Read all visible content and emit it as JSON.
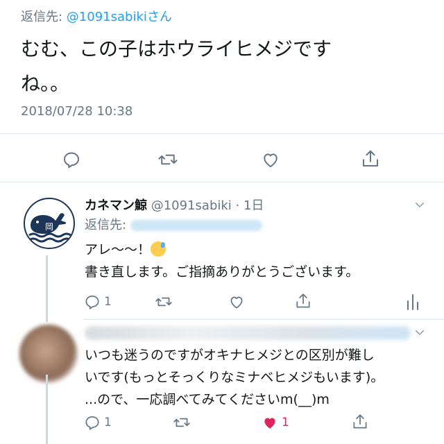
{
  "main_tweet": {
    "reply_prefix": "返信先: ",
    "reply_handle": "@1091sabikiさん",
    "text_line1": "むむ、この子はホウライヒメジです",
    "text_line2": "ね。。",
    "timestamp": "2018/07/28 10:38"
  },
  "reply1": {
    "name": "カネマン鯨",
    "meta": " @1091sabiki · 1日",
    "reply_prefix": "返信先:",
    "text_line1": "アレ〜〜！",
    "text_line2": "書き直します。ご指摘ありがとうございます。",
    "reply_count": "1",
    "avatar_label": "岡"
  },
  "reply2": {
    "text_line1": "いつも迷うのですがオキナヒメジとの区別が難し",
    "text_line2": "いです(もっとそっくりなミナベヒメジもいます)。",
    "text_line3": "...ので、一応調べてみてくださいm(__)m",
    "reply_count": "1",
    "like_count": "1"
  },
  "colors": {
    "accent": "#1da1f2",
    "secondary_text": "#657786",
    "like_red": "#e0245e",
    "divider": "#e1e8ed",
    "avatar_navy": "#1d3557"
  },
  "icons": [
    "reply-icon",
    "retweet-icon",
    "like-icon",
    "share-icon",
    "chevron-down-icon",
    "analytics-icon",
    "heart-filled-icon"
  ]
}
